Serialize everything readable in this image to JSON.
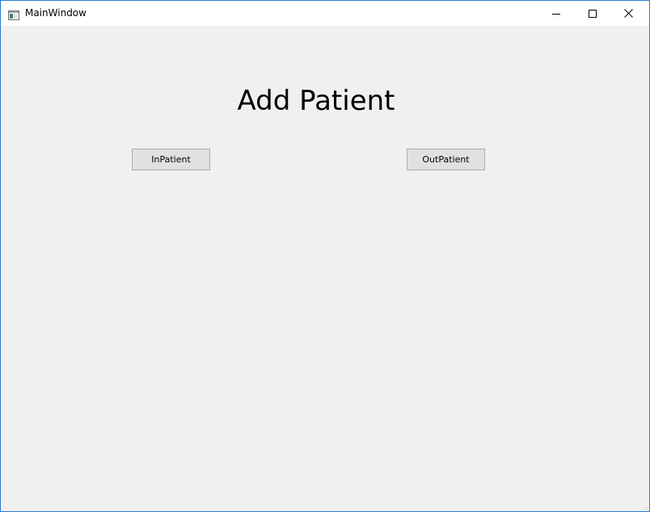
{
  "window": {
    "title": "MainWindow",
    "icon": "app-window-icon",
    "controls": {
      "minimize_icon": "minimize-icon",
      "maximize_icon": "maximize-icon",
      "close_icon": "close-icon"
    },
    "border_color": "#2a7ad2"
  },
  "main": {
    "heading": "Add Patient",
    "buttons": {
      "inpatient_label": "InPatient",
      "outpatient_label": "OutPatient"
    },
    "background": "#f0f0f0"
  },
  "statusbar": {
    "grip_icon": "size-grip-icon"
  }
}
